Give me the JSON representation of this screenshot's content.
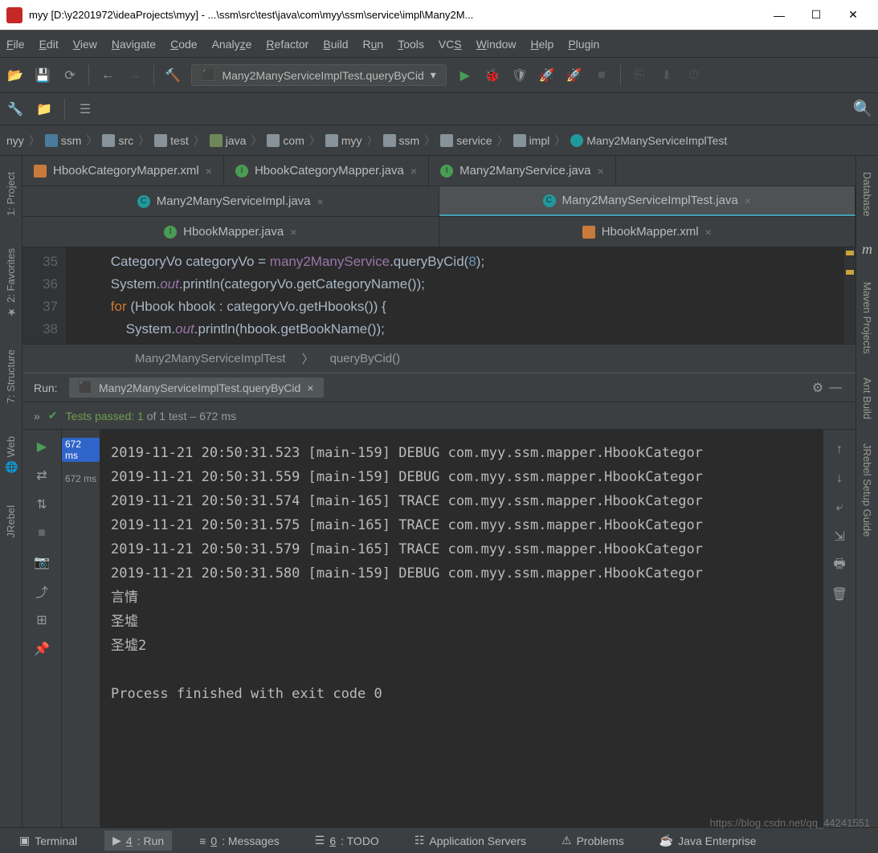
{
  "window": {
    "title": "myy [D:\\y2201972\\ideaProjects\\myy] - ...\\ssm\\src\\test\\java\\com\\myy\\ssm\\service\\impl\\Many2M..."
  },
  "menu": {
    "file": "File",
    "edit": "Edit",
    "view": "View",
    "navigate": "Navigate",
    "code": "Code",
    "analyze": "Analyze",
    "refactor": "Refactor",
    "build": "Build",
    "run": "Run",
    "tools": "Tools",
    "vcs": "VCS",
    "window": "Window",
    "help": "Help",
    "plugin": "Plugin"
  },
  "toolbar": {
    "run_config": "Many2ManyServiceImplTest.queryByCid"
  },
  "breadcrumb": [
    "nyy",
    "ssm",
    "src",
    "test",
    "java",
    "com",
    "myy",
    "ssm",
    "service",
    "impl",
    "Many2ManyServiceImplTest"
  ],
  "tabs": {
    "row1": [
      {
        "label": "HbookCategoryMapper.xml"
      },
      {
        "label": "HbookCategoryMapper.java"
      },
      {
        "label": "Many2ManyService.java"
      }
    ],
    "row2": [
      {
        "label": "Many2ManyServiceImpl.java"
      },
      {
        "label": "Many2ManyServiceImplTest.java",
        "active": true
      }
    ],
    "row3": [
      {
        "label": "HbookMapper.java"
      },
      {
        "label": "HbookMapper.xml"
      }
    ]
  },
  "editor": {
    "lines": [
      35,
      36,
      37,
      38
    ],
    "code35": "CategoryVo categoryVo = many2ManyService.queryByCid(8);",
    "code36": "System.out.println(categoryVo.getCategoryName());",
    "code37": "for (Hbook hbook : categoryVo.getHbooks()) {",
    "code38": "    System.out.println(hbook.getBookName());"
  },
  "crumb2": {
    "cls": "Many2ManyServiceImplTest",
    "method": "queryByCid()"
  },
  "run": {
    "label": "Run:",
    "tab": "Many2ManyServiceImplTest.queryByCid",
    "tests_passed": "Tests passed: 1",
    "tests_rest": " of 1 test – 672 ms",
    "time1": "672 ms",
    "time2": "672 ms",
    "console": [
      "2019-11-21 20:50:31.523 [main-159] DEBUG com.myy.ssm.mapper.HbookCategor",
      "2019-11-21 20:50:31.559 [main-159] DEBUG com.myy.ssm.mapper.HbookCategor",
      "2019-11-21 20:50:31.574 [main-165] TRACE com.myy.ssm.mapper.HbookCategor",
      "2019-11-21 20:50:31.575 [main-165] TRACE com.myy.ssm.mapper.HbookCategor",
      "2019-11-21 20:50:31.579 [main-165] TRACE com.myy.ssm.mapper.HbookCategor",
      "2019-11-21 20:50:31.580 [main-159] DEBUG com.myy.ssm.mapper.HbookCategor",
      "言情",
      "圣墟",
      "圣墟2",
      "",
      "Process finished with exit code 0"
    ]
  },
  "leftrail": [
    "1: Project",
    "2: Favorites",
    "7: Structure",
    "Web",
    "JRebel"
  ],
  "rightrail": [
    "Database",
    "Maven Projects",
    "Ant Build",
    "JRebel Setup Guide"
  ],
  "bottom": {
    "terminal": "Terminal",
    "run": "4: Run",
    "messages": "0: Messages",
    "todo": "6: TODO",
    "appserv": "Application Servers",
    "problems": "Problems",
    "javaee": "Java Enterprise"
  },
  "watermark": "https://blog.csdn.net/qq_44241551"
}
